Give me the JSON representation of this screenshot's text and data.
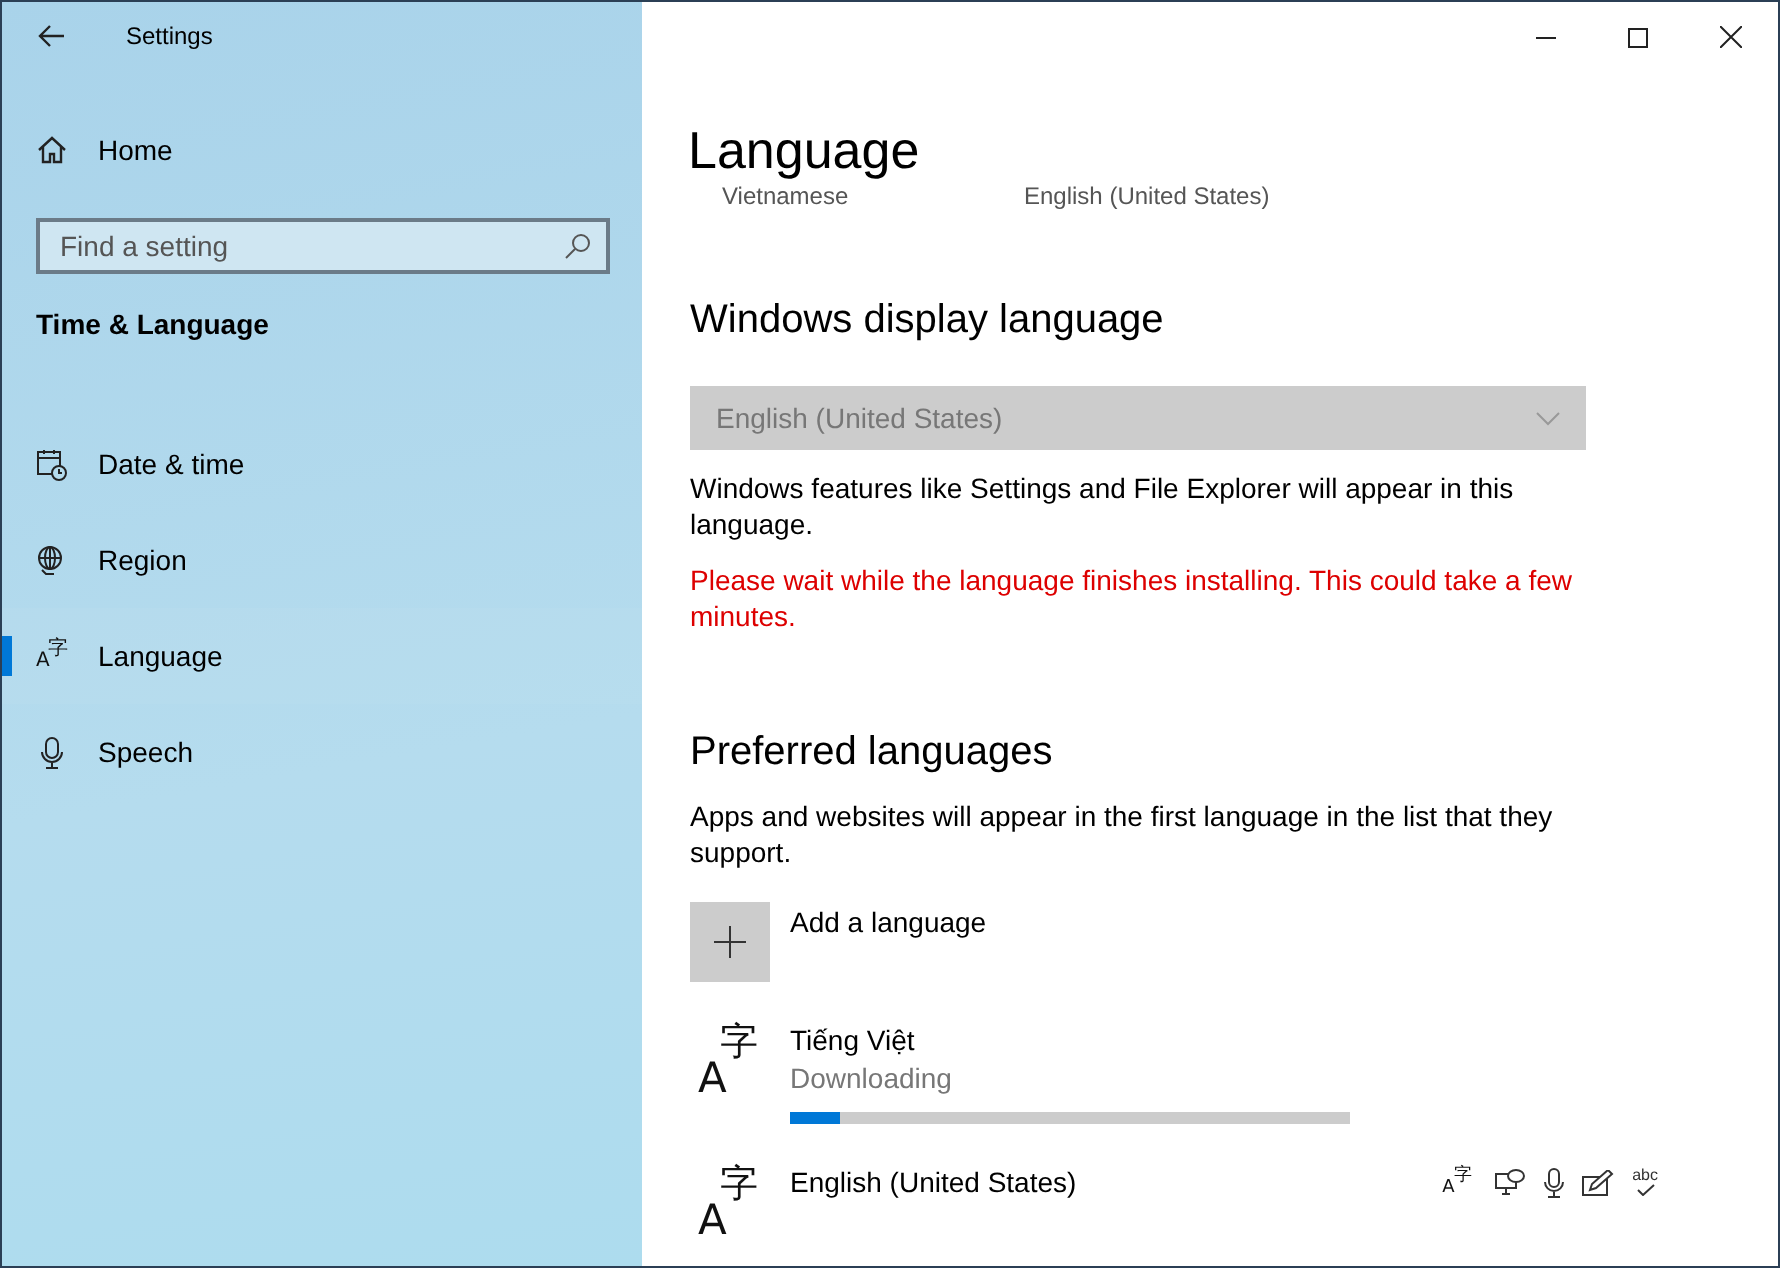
{
  "window": {
    "title": "Settings"
  },
  "sidebar": {
    "home": "Home",
    "search": {
      "placeholder": "Find a setting"
    },
    "section": "Time & Language",
    "items": [
      {
        "kind": "date",
        "label": "Date & time",
        "selected": false
      },
      {
        "kind": "region",
        "label": "Region",
        "selected": false
      },
      {
        "kind": "language",
        "label": "Language",
        "selected": true,
        "glyphs": [
          "A",
          "字"
        ]
      },
      {
        "kind": "speech",
        "label": "Speech",
        "selected": false
      }
    ]
  },
  "page": {
    "title": "Language",
    "subtitles": [
      "Vietnamese",
      "English (United States)"
    ]
  },
  "display_language": {
    "heading": "Windows display language",
    "dropdown": {
      "value": "English (United States)",
      "disabled": true
    },
    "description": "Windows features like Settings and File Explorer will appear in this language.",
    "warning": "Please wait while the language finishes installing. This could take a few minutes."
  },
  "preferred": {
    "heading": "Preferred languages",
    "description": "Apps and websites will appear in the first language in the list that they support.",
    "add_button": "Add a language",
    "languages": [
      {
        "name": "Tiếng Việt",
        "glyphs": [
          "A",
          "字"
        ],
        "status": "Downloading",
        "level": 0.09
      },
      {
        "name": "English (United States)",
        "glyphs": [
          "A",
          "字"
        ],
        "features": [
          {
            "kind": "language",
            "glyphs": [
              "A",
              "字"
            ]
          },
          {
            "kind": "speech-bubble"
          },
          {
            "kind": "microphone"
          },
          {
            "kind": "handwriting"
          },
          {
            "kind": "spelling",
            "text": "abc"
          }
        ]
      }
    ]
  }
}
